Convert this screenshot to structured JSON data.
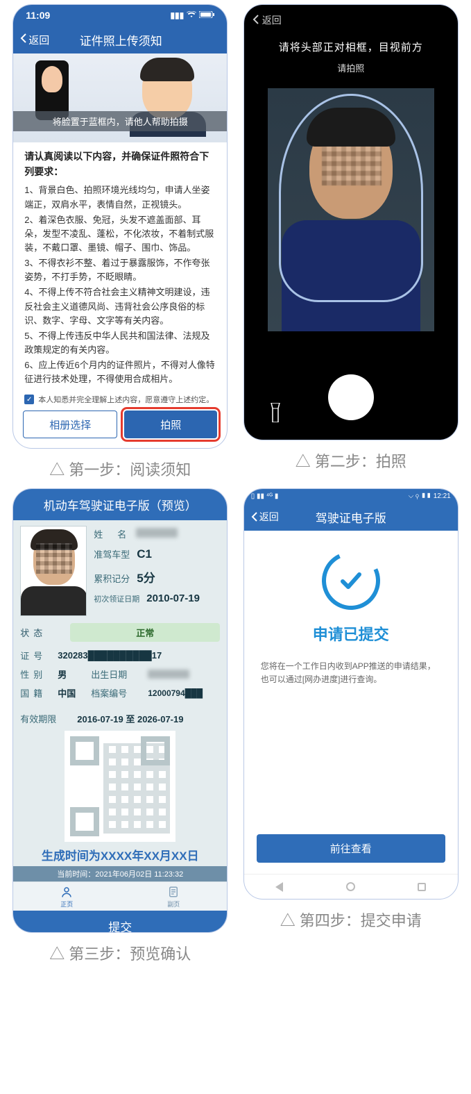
{
  "captions": {
    "step1": "△ 第一步：阅读须知",
    "step2": "△ 第二步：拍照",
    "step3": "△ 第三步：预览确认",
    "step4": "△ 第四步：提交申请"
  },
  "screen1": {
    "status_time": "11:09",
    "back_label": "返回",
    "title": "证件照上传须知",
    "hero_strip": "将脸置于蓝框内，请他人帮助拍摄",
    "lead": "请认真阅读以下内容，并确保证件照符合下列要求：",
    "rules": [
      "1、背景白色、拍照环境光线均匀，申请人坐姿端正，双肩水平，表情自然，正视镜头。",
      "2、着深色衣服、免冠，头发不遮盖面部、耳朵，发型不凌乱、蓬松，不化浓妆，不着制式服装，不戴口罩、墨镜、帽子、围巾、饰品。",
      "3、不得衣衫不整、着过于暴露服饰，不作夸张姿势，不打手势，不眨眼睛。",
      "4、不得上传不符合社会主义精神文明建设，违反社会主义道德风尚、违背社会公序良俗的标识、数字、字母、文字等有关内容。",
      "5、不得上传违反中华人民共和国法律、法规及政策规定的有关内容。",
      "6、应上传近6个月内的证件照片，不得对人像特征进行技术处理，不得使用合成相片。"
    ],
    "agree_text": "本人知悉并完全理解上述内容，愿意遵守上述约定。",
    "btn_album": "相册选择",
    "btn_shoot": "拍照"
  },
  "screen2": {
    "back_label": "返回",
    "tip1": "请将头部正对相框，目视前方",
    "tip2": "请拍照"
  },
  "screen3": {
    "title": "机动车驾驶证电子版（预览）",
    "labels": {
      "name": "姓　名",
      "cartype": "准驾车型",
      "points": "累积记分",
      "firstdate": "初次领证日期",
      "status": "状态",
      "idno": "证号",
      "sex": "性别",
      "birth": "出生日期",
      "nation": "国籍",
      "fileno": "档案编号",
      "valid": "有效期限"
    },
    "values": {
      "cartype": "C1",
      "points": "5分",
      "firstdate": "2010-07-19",
      "status": "正常",
      "idno": "320283██████████17",
      "sex": "男",
      "nation": "中国",
      "fileno": "12000794███",
      "valid": "2016-07-19 至 2026-07-19"
    },
    "generated_line": "生成时间为XXXX年XX月XX日",
    "current_time_line": "当前时间：2021年06月02日 11:23:32",
    "tab_main": "正页",
    "tab_sub": "副页",
    "submit": "提交"
  },
  "screen4": {
    "status_time": "12:21",
    "back_label": "返回",
    "title": "驾驶证电子版",
    "heading": "申请已提交",
    "paragraph": "您将在一个工作日内收到APP推送的申请结果，也可以通过[网办进度]进行查询。",
    "view_btn": "前往查看"
  }
}
